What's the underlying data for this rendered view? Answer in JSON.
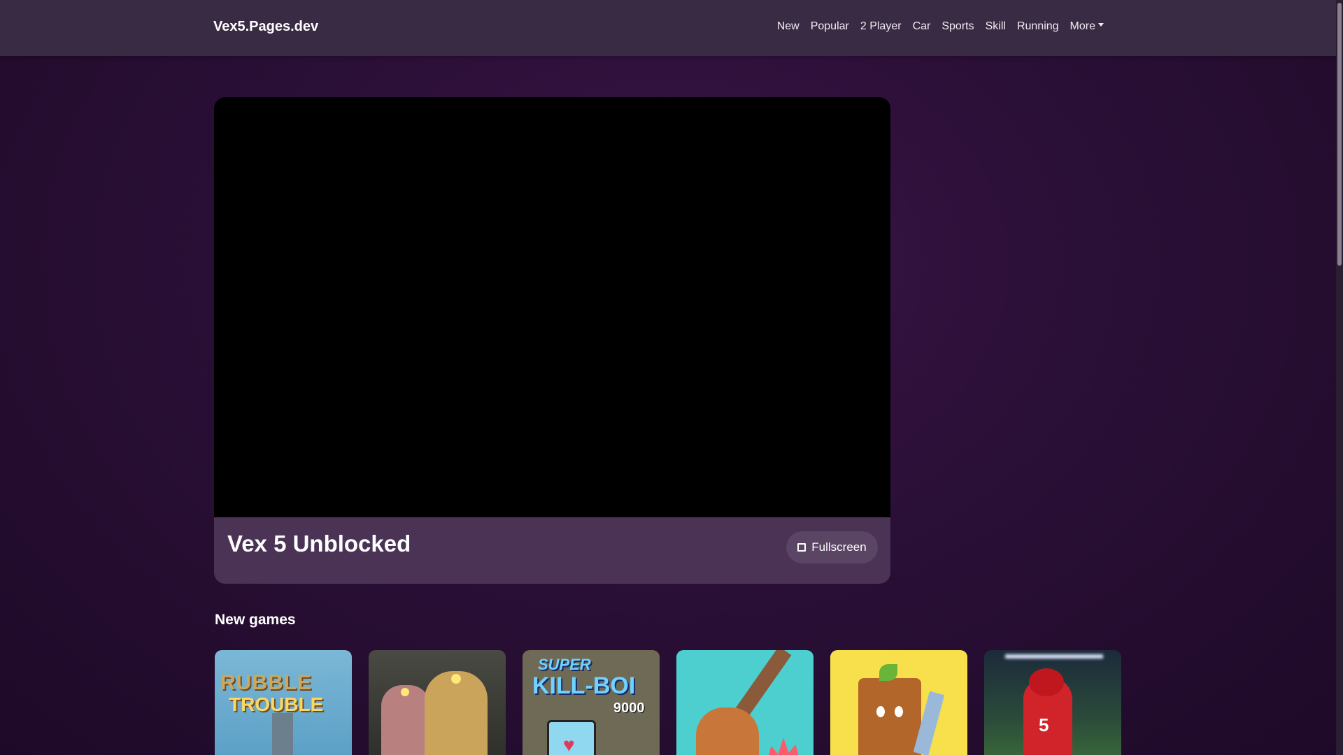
{
  "nav": {
    "brand": "Vex5.Pages.dev",
    "links": [
      "New",
      "Popular",
      "2 Player",
      "Car",
      "Sports",
      "Skill",
      "Running",
      "More"
    ]
  },
  "game": {
    "title": "Vex 5 Unblocked",
    "fullscreen_label": "Fullscreen",
    "fullscreen_icon": "expand-icon"
  },
  "sections": {
    "new_games_title": "New games",
    "new_games_thumbs": [
      "thumb-1",
      "thumb-2",
      "thumb-3",
      "thumb-4",
      "thumb-5",
      "thumb-6"
    ]
  },
  "thumb_text": {
    "t1_line1": "RUBBLE",
    "t1_line2": "TROUBLE",
    "t3_line1": "SUPER",
    "t3_line2": "KILL-BOI",
    "t3_line3": "9000",
    "t6_number": "5"
  },
  "colors": {
    "navbar": "#3a2b44",
    "card": "#4a3354",
    "button": "#5a4564"
  }
}
